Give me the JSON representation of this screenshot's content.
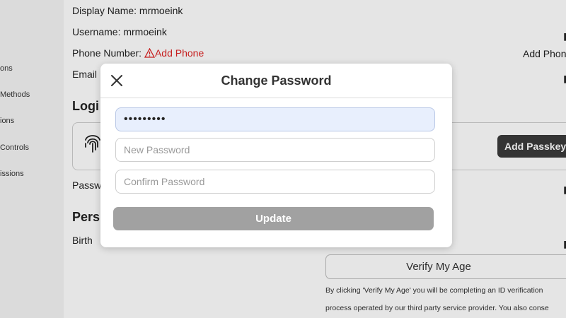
{
  "sidebar": {
    "items": [
      {
        "label": "ons"
      },
      {
        "label": "Methods"
      },
      {
        "label": "ions"
      },
      {
        "label": "Controls"
      },
      {
        "label": "issions"
      }
    ]
  },
  "account": {
    "display_name": "Display Name:  mrmoeink",
    "username": "Username: mrmoeink",
    "phone_label": "Phone Number:",
    "add_phone": "Add Phone",
    "add_phone_right": "Add Phon",
    "email_label": "Email",
    "login_heading": "Logi",
    "passkey_button": "Add Passkey",
    "password_label": "Passw",
    "personal_heading": "Pers",
    "birthday_label": "Birth"
  },
  "verify": {
    "button": "Verify My Age",
    "legal_line1": "By clicking 'Verify My Age' you will be completing an ID verification",
    "legal_line2": "process operated by our third party service provider. You also conse"
  },
  "modal": {
    "title": "Change Password",
    "current_password_value": "•••••••••",
    "new_password_placeholder": "New Password",
    "confirm_password_placeholder": "Confirm Password",
    "update_label": "Update"
  },
  "colors": {
    "warning": "#dd2222",
    "update_disabled": "#a1a1a1",
    "filled_field": "#e8effd"
  }
}
